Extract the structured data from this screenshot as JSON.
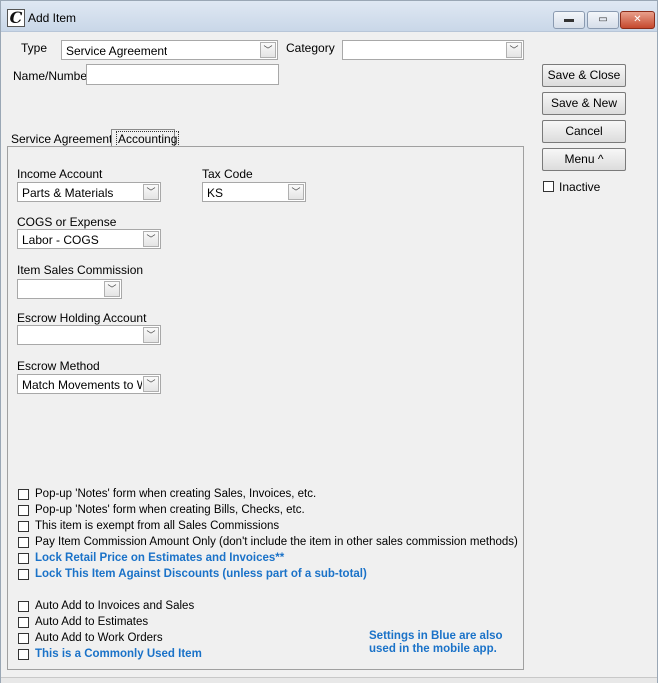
{
  "window": {
    "title": "Add Item",
    "app_icon_glyph": "C"
  },
  "titlebar_buttons": {
    "minimize": "▬",
    "maximize": "▭",
    "close": "✕"
  },
  "header": {
    "type_label": "Type",
    "type_value": "Service Agreement",
    "category_label": "Category",
    "category_value": "",
    "name_label": "Name/Number",
    "name_value": ""
  },
  "buttons": {
    "save_close": "Save & Close",
    "save_new": "Save & New",
    "cancel": "Cancel",
    "menu": "Menu ^"
  },
  "inactive_label": "Inactive",
  "tabs": {
    "service_agreement": "Service Agreement",
    "accounting": "Accounting"
  },
  "accounting": {
    "income_account_label": "Income Account",
    "income_account_value": "Parts & Materials",
    "tax_code_label": "Tax Code",
    "tax_code_value": "KS",
    "cogs_label": "COGS or Expense",
    "cogs_value": "Labor - COGS",
    "commission_label": "Item Sales Commission",
    "commission_value": "",
    "escrow_account_label": "Escrow Holding Account",
    "escrow_account_value": "",
    "escrow_method_label": "Escrow Method",
    "escrow_method_value": "Match Movements to Wo"
  },
  "checkboxes": [
    {
      "label": "Pop-up 'Notes' form when creating Sales, Invoices, etc.",
      "checked": false,
      "blue": false
    },
    {
      "label": "Pop-up 'Notes' form when creating Bills, Checks, etc.",
      "checked": false,
      "blue": false
    },
    {
      "label": "This item is exempt from all Sales Commissions",
      "checked": false,
      "blue": false
    },
    {
      "label": "Pay Item Commission Amount Only (don't include the item in other sales commission methods)",
      "checked": false,
      "blue": false
    },
    {
      "label": "Lock Retail Price on Estimates and Invoices**",
      "checked": false,
      "blue": true
    },
    {
      "label": "Lock This Item Against Discounts (unless part of a sub-total)",
      "checked": false,
      "blue": true
    },
    {
      "label": "Auto Add to Invoices and Sales",
      "checked": false,
      "blue": false
    },
    {
      "label": "Auto Add to Estimates",
      "checked": false,
      "blue": false
    },
    {
      "label": "Auto Add to Work Orders",
      "checked": false,
      "blue": false
    },
    {
      "label": "This is a Commonly Used Item",
      "checked": false,
      "blue": true
    }
  ],
  "mobile_note": "Settings in Blue are also used in the mobile app.",
  "colors": {
    "blue_setting": "#1a72c8",
    "window_bg": "#f0f0f0"
  },
  "dropdown_arrow": "﹀"
}
